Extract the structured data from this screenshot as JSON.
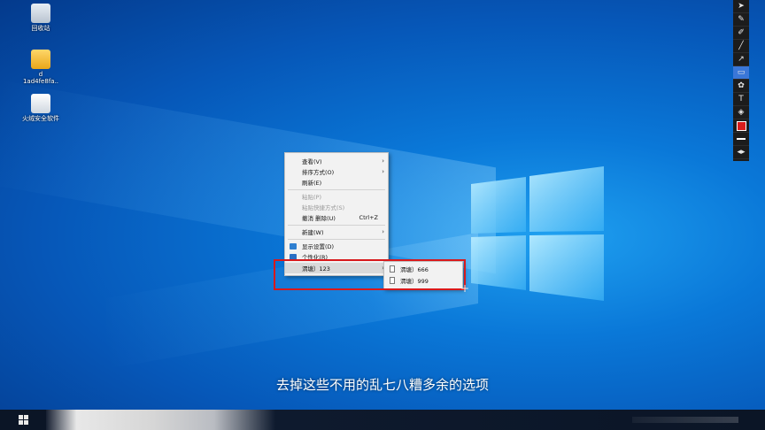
{
  "desktop": {
    "icons": [
      {
        "label": "回收站"
      },
      {
        "label": "d\n1ad4fe8fa.."
      },
      {
        "label": "火绒安全软件"
      }
    ]
  },
  "context_menu": {
    "items": [
      {
        "label": "查看(V)"
      },
      {
        "label": "排序方式(O)"
      },
      {
        "label": "刷新(E)"
      },
      {
        "label": "粘贴(P)"
      },
      {
        "label": "粘贴快捷方式(S)"
      },
      {
        "label": "撤消 删除(U)",
        "shortcut": "Ctrl+Z"
      },
      {
        "label": "新建(W)"
      },
      {
        "label": "显示设置(D)"
      },
      {
        "label": "个性化(R)"
      },
      {
        "label": "渭塘）123"
      }
    ]
  },
  "submenu": {
    "items": [
      {
        "label": "渭塘）666"
      },
      {
        "label": "渭塘）999"
      }
    ]
  },
  "subtitle": "去掉这些不用的乱七八糟多余的选项",
  "colors": {
    "highlight": "#d8191c",
    "toolbar_active": "#3a77d8",
    "selected_color": "#d81c1c"
  }
}
